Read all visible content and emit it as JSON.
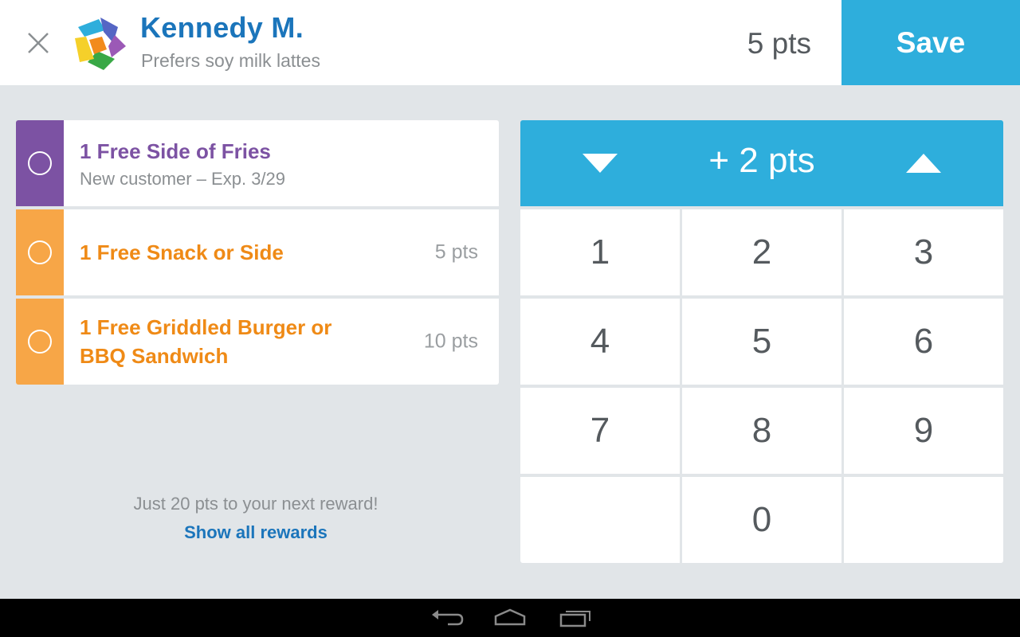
{
  "header": {
    "customer_name": "Kennedy M.",
    "customer_note": "Prefers soy milk lattes",
    "points_total": "5 pts",
    "save_label": "Save",
    "close_icon": "close-icon",
    "logo_icon": "pinwheel-logo-icon"
  },
  "rewards": [
    {
      "title": "1 Free Side of Fries",
      "subtitle": "New customer – Exp. 3/29",
      "points": "",
      "accent": "#7c52a3",
      "text_color": "#7c52a3"
    },
    {
      "title": "1 Free Snack or Side",
      "subtitle": "",
      "points": "5 pts",
      "accent": "#f7a647",
      "text_color": "#ef8a16"
    },
    {
      "title_line1": "1 Free Griddled Burger or",
      "title_line2": "BBQ Sandwich",
      "subtitle": "",
      "points": "10 pts",
      "accent": "#f7a647",
      "text_color": "#ef8a16"
    }
  ],
  "footer": {
    "next_reward": "Just 20 pts to your next reward!",
    "show_all": "Show all rewards"
  },
  "keypad": {
    "points_value": "+ 2 pts",
    "decrement_icon": "triangle-down-icon",
    "increment_icon": "triangle-up-icon",
    "keys": [
      "1",
      "2",
      "3",
      "4",
      "5",
      "6",
      "7",
      "8",
      "9",
      "",
      "0",
      ""
    ]
  },
  "navbar": {
    "icons": [
      "back-icon",
      "home-icon",
      "recent-apps-icon"
    ]
  },
  "colors": {
    "brand_blue": "#1b75bb",
    "accent_cyan": "#2eaedc",
    "purple": "#7c52a3",
    "orange": "#ef8a16",
    "background": "#e1e5e8"
  }
}
